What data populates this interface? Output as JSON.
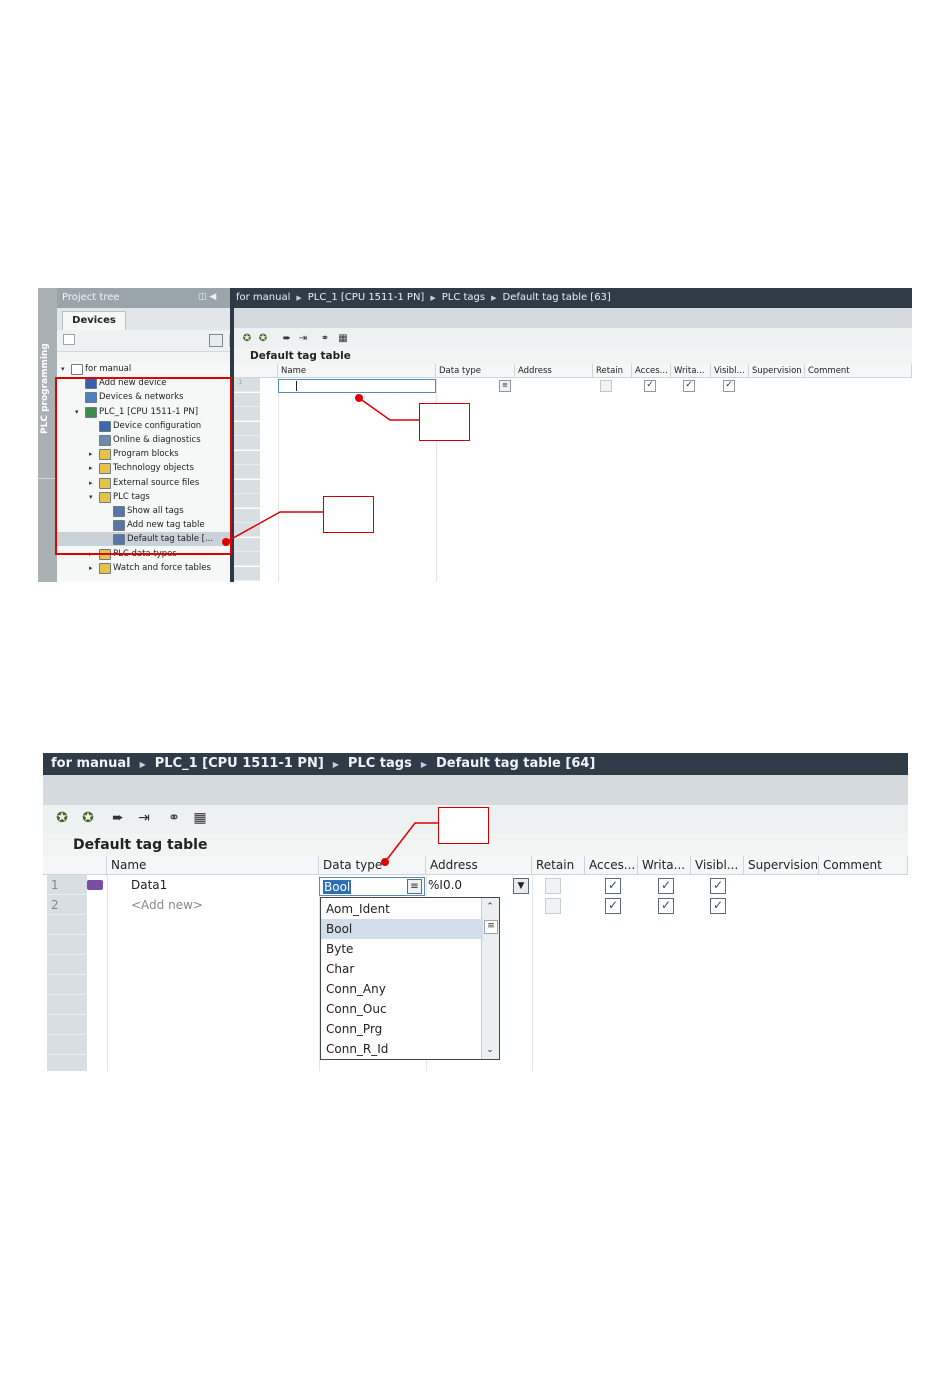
{
  "shot1": {
    "ribbon_label": "PLC programming",
    "project_tree_title": "Project tree",
    "devices_tab": "Devices",
    "tree": [
      {
        "label": "for manual",
        "icon": "project-icon",
        "color": "#ffffff"
      },
      {
        "label": "Add new device",
        "icon": "add-device-icon",
        "color": "#3a5fae"
      },
      {
        "label": "Devices & networks",
        "icon": "network-icon",
        "color": "#4a82c4"
      },
      {
        "label": "PLC_1 [CPU 1511-1 PN]",
        "icon": "cpu-icon",
        "color": "#3d8c4d"
      },
      {
        "label": "Device configuration",
        "icon": "device-config-icon",
        "color": "#3a6aa8"
      },
      {
        "label": "Online & diagnostics",
        "icon": "diagnostics-icon",
        "color": "#6e8ca8"
      },
      {
        "label": "Program blocks",
        "icon": "folder-icon",
        "color": "#e5c34a"
      },
      {
        "label": "Technology objects",
        "icon": "folder-icon",
        "color": "#e5c34a"
      },
      {
        "label": "External source files",
        "icon": "folder-icon",
        "color": "#e5c34a"
      },
      {
        "label": "PLC tags",
        "icon": "folder-open-icon",
        "color": "#e5c34a"
      },
      {
        "label": "Show all tags",
        "icon": "tags-icon",
        "color": "#5a76a8"
      },
      {
        "label": "Add new tag table",
        "icon": "add-table-icon",
        "color": "#5a76a8"
      },
      {
        "label": "Default tag table [...",
        "icon": "tag-table-icon",
        "color": "#5a76a8"
      },
      {
        "label": "PLC data types",
        "icon": "folder-icon",
        "color": "#e5c34a"
      },
      {
        "label": "Watch and force tables",
        "icon": "folder-icon",
        "color": "#e5c34a"
      }
    ],
    "breadcrumb": [
      "for manual",
      "PLC_1 [CPU 1511-1 PN]",
      "PLC tags",
      "Default tag table [63]"
    ],
    "table_title": "Default tag table",
    "columns": [
      "Name",
      "Data type",
      "Address",
      "Retain",
      "Acces...",
      "Writa...",
      "Visibl...",
      "Supervision",
      "Comment"
    ],
    "row1_num": "1"
  },
  "shot2": {
    "breadcrumb": [
      "for manual",
      "PLC_1 [CPU 1511-1 PN]",
      "PLC tags",
      "Default tag table [64]"
    ],
    "table_title": "Default tag table",
    "columns": [
      "Name",
      "Data type",
      "Address",
      "Retain",
      "Acces...",
      "Writa...",
      "Visibl...",
      "Supervision",
      "Comment"
    ],
    "rows": [
      {
        "num": "1",
        "name": "Data1",
        "data_type": "Bool",
        "address": "%I0.0"
      },
      {
        "num": "2",
        "name": "<Add new>"
      }
    ],
    "dropdown_options": [
      "Aom_Ident",
      "Bool",
      "Byte",
      "Char",
      "Conn_Any",
      "Conn_Ouc",
      "Conn_Prg",
      "Conn_R_Id"
    ],
    "selected_option": "Bool"
  },
  "accent_red": "#e00000"
}
